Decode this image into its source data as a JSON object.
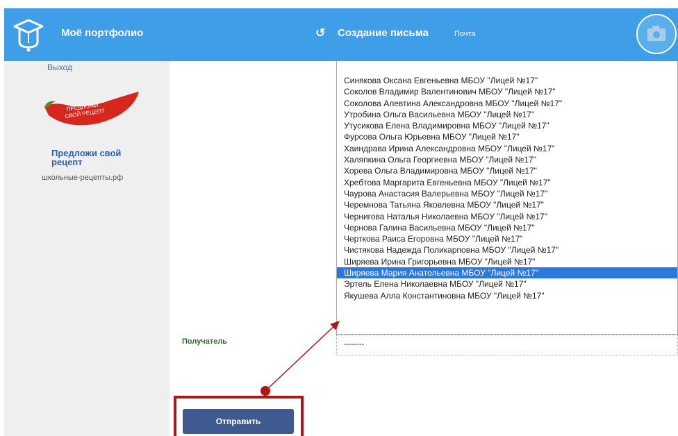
{
  "header": {
    "brand": "Моё портфолио",
    "title": "Создание письма",
    "subtitle": "Почта",
    "refresh_icon": "↺",
    "camera_icon": "camera-icon"
  },
  "sidebar": {
    "exit": "Выход",
    "promo": {
      "title": "Предложи свой рецепт",
      "link": "школьные-рецепты.рф",
      "image_text": "ПРЕДЛОЖИ СВОЙ РЕЦЕПТ"
    }
  },
  "recipients": {
    "label": "Получатель",
    "selected_value": "--------",
    "options": [
      "Синякова Оксана Евгеньевна МБОУ \"Лицей №17\"",
      "Соколов Владимир Валентинович МБОУ \"Лицей №17\"",
      "Соколова Алевтина Александровна МБОУ \"Лицей №17\"",
      "Утробина Ольга Васильевна МБОУ \"Лицей №17\"",
      "Утусикова Елена Владимировна МБОУ \"Лицей №17\"",
      "Фурсова Ольга Юрьевна МБОУ \"Лицей №17\"",
      "Хаиндрава Ирина Александровна МБОУ \"Лицей №17\"",
      "Халяпкина Ольга Георгиевна МБОУ \"Лицей №17\"",
      "Хорева Ольга Владимировна МБОУ \"Лицей №17\"",
      "Хребтова Маргарита Евгеньевна МБОУ \"Лицей №17\"",
      "Чаурова Анастасия Валерьевна МБОУ \"Лицей №17\"",
      "Черемнова Татьяна Яковлевна МБОУ \"Лицей №17\"",
      "Чернигова Наталья Николаевна МБОУ \"Лицей №17\"",
      "Чернова Галина Васильевна МБОУ \"Лицей №17\"",
      "Черткова Раиса Егоровна МБОУ \"Лицей №17\"",
      "Чистякова Надежда Поликарповна МБОУ \"Лицей №17\"",
      "Ширяева Ирина Григорьевна МБОУ \"Лицей №17\"",
      "Ширяева Мария Анатольевна МБОУ \"Лицей №17\"",
      "Эртель Елена Николаевна МБОУ \"Лицей №17\"",
      "Якушева Алла Константиновна МБОУ \"Лицей №17\""
    ],
    "highlighted_index": 17
  },
  "actions": {
    "send": "Отправить"
  },
  "colors": {
    "header": "#3f9ee8",
    "selection": "#2a79e0",
    "annotation": "#b11616",
    "button": "#3f5a8f"
  }
}
